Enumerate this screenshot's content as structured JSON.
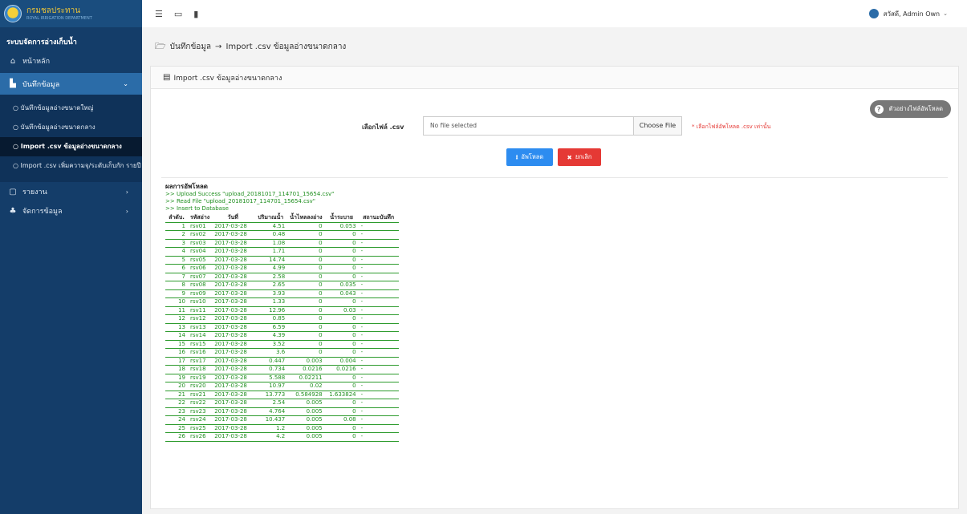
{
  "header": {
    "logo_title": "กรมชลประทาน",
    "logo_subtitle": "ROYAL IRRIGATION DEPARTMENT",
    "user_label": "สวัสดี, Admin Own"
  },
  "sidebar": {
    "system_title": "ระบบจัดการอ่างเก็บน้ำ",
    "home": "หน้าหลัก",
    "record": "บันทึกข้อมูล",
    "sub_items": [
      "บันทึกข้อมูลอ่างขนาดใหญ่",
      "บันทึกข้อมูลอ่างขนาดกลาง",
      "Import .csv ข้อมูลอ่างขนาดกลาง",
      "Import .csv เพิ่มความจุ/ระดับเก็บกัก รายปี"
    ],
    "report": "รายงาน",
    "manage": "จัดการข้อมูล"
  },
  "breadcrumb": {
    "parent": "บันทึกข้อมูล",
    "arrow": "→",
    "current": "Import .csv ข้อมูลอ่างขนาดกลาง"
  },
  "panel": {
    "title": "Import .csv ข้อมูลอ่างขนาดกลาง",
    "sample_button": "ตัวอย่างไฟล์อัพโหลด",
    "file_label": "เลือกไฟล์ .csv",
    "file_placeholder": "No file selected",
    "choose_file": "Choose File",
    "file_note": "* เลือกไฟล์อัพโหลด .csv เท่านั้น",
    "upload_button": "อัพโหลด",
    "cancel_button": "ยกเลิก"
  },
  "result": {
    "title": "ผลการอัพโหลด",
    "log": [
      ">> Upload Success \"upload_20181017_114701_15654.csv\"",
      ">> Read File \"upload_20181017_114701_15654.csv\"",
      ">> Insert to Database"
    ],
    "columns": [
      "ลำดับ.",
      "รหัสอ่าง",
      "วันที่",
      "ปริมาณน้ำ",
      "น้ำไหลลงอ่าง",
      "น้ำระบาย",
      "สถานะบันทึก"
    ],
    "rows": [
      [
        "1",
        "rsv01",
        "2017-03-28",
        "4.51",
        "0",
        "0.053",
        "-"
      ],
      [
        "2",
        "rsv02",
        "2017-03-28",
        "0.48",
        "0",
        "0",
        "-"
      ],
      [
        "3",
        "rsv03",
        "2017-03-28",
        "1.08",
        "0",
        "0",
        "-"
      ],
      [
        "4",
        "rsv04",
        "2017-03-28",
        "1.71",
        "0",
        "0",
        "-"
      ],
      [
        "5",
        "rsv05",
        "2017-03-28",
        "14.74",
        "0",
        "0",
        "-"
      ],
      [
        "6",
        "rsv06",
        "2017-03-28",
        "4.99",
        "0",
        "0",
        "-"
      ],
      [
        "7",
        "rsv07",
        "2017-03-28",
        "2.58",
        "0",
        "0",
        "-"
      ],
      [
        "8",
        "rsv08",
        "2017-03-28",
        "2.65",
        "0",
        "0.035",
        "-"
      ],
      [
        "9",
        "rsv09",
        "2017-03-28",
        "3.93",
        "0",
        "0.043",
        "-"
      ],
      [
        "10",
        "rsv10",
        "2017-03-28",
        "1.33",
        "0",
        "0",
        "-"
      ],
      [
        "11",
        "rsv11",
        "2017-03-28",
        "12.96",
        "0",
        "0.03",
        "-"
      ],
      [
        "12",
        "rsv12",
        "2017-03-28",
        "0.85",
        "0",
        "0",
        "-"
      ],
      [
        "13",
        "rsv13",
        "2017-03-28",
        "6.59",
        "0",
        "0",
        "-"
      ],
      [
        "14",
        "rsv14",
        "2017-03-28",
        "4.39",
        "0",
        "0",
        "-"
      ],
      [
        "15",
        "rsv15",
        "2017-03-28",
        "3.52",
        "0",
        "0",
        "-"
      ],
      [
        "16",
        "rsv16",
        "2017-03-28",
        "3.6",
        "0",
        "0",
        "-"
      ],
      [
        "17",
        "rsv17",
        "2017-03-28",
        "0.447",
        "0.003",
        "0.004",
        "-"
      ],
      [
        "18",
        "rsv18",
        "2017-03-28",
        "0.734",
        "0.0216",
        "0.0216",
        "-"
      ],
      [
        "19",
        "rsv19",
        "2017-03-28",
        "5.588",
        "0.02211",
        "0",
        "-"
      ],
      [
        "20",
        "rsv20",
        "2017-03-28",
        "10.97",
        "0.02",
        "0",
        "-"
      ],
      [
        "21",
        "rsv21",
        "2017-03-28",
        "13.773",
        "0.584928",
        "1.633824",
        "-"
      ],
      [
        "22",
        "rsv22",
        "2017-03-28",
        "2.54",
        "0.005",
        "0",
        "-"
      ],
      [
        "23",
        "rsv23",
        "2017-03-28",
        "4.764",
        "0.005",
        "0",
        "-"
      ],
      [
        "24",
        "rsv24",
        "2017-03-28",
        "10.437",
        "0.005",
        "0.08",
        "-"
      ],
      [
        "25",
        "rsv25",
        "2017-03-28",
        "1.2",
        "0.005",
        "0",
        "-"
      ],
      [
        "26",
        "rsv26",
        "2017-03-28",
        "4.2",
        "0.005",
        "0",
        "-"
      ]
    ]
  },
  "icons": {
    "menu": "menu-icon",
    "monitor": "monitor-icon",
    "document": "document-icon"
  },
  "colors": {
    "sidebar": "#143d69",
    "active_nav": "#2b6ca8",
    "upload": "#2d8cf0",
    "cancel": "#e53935",
    "success_text": "#1f8f1f"
  }
}
